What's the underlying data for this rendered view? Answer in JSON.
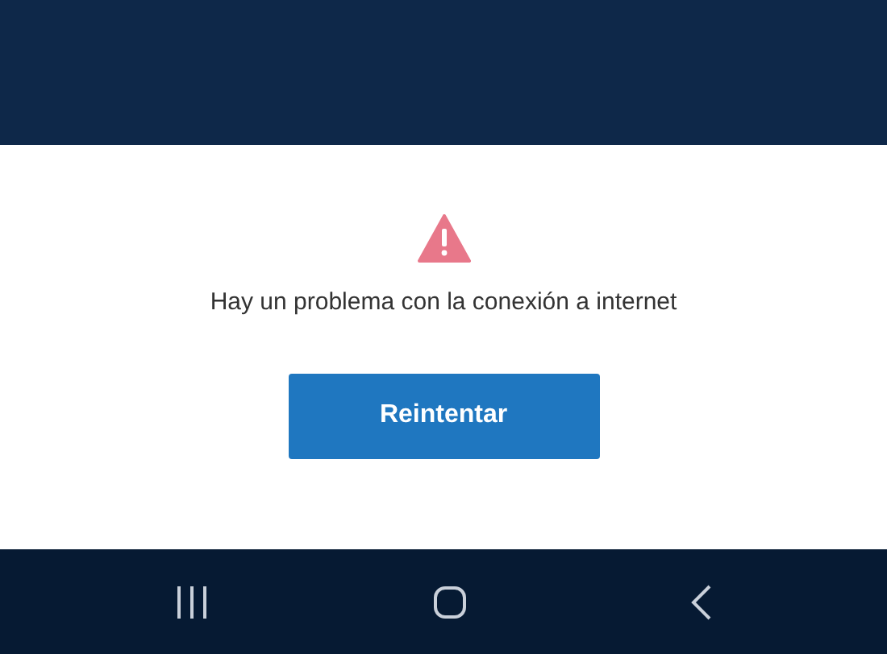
{
  "message": "Hay un problema con la conexión a internet",
  "button": {
    "label": "Reintentar"
  }
}
